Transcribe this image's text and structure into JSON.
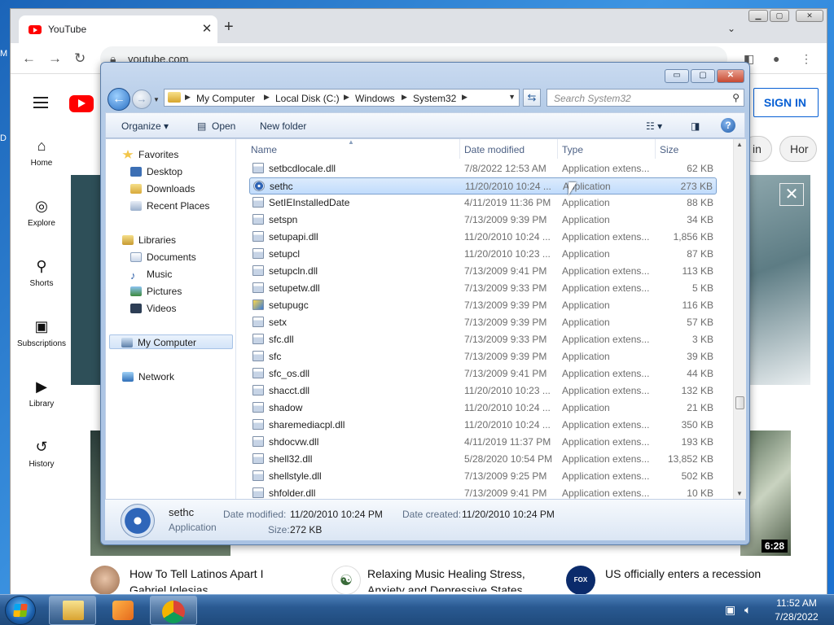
{
  "desktop": {
    "edge_labels": [
      "M",
      "D"
    ]
  },
  "chrome": {
    "tab_title": "YouTube",
    "url": "youtube.com",
    "new_tab": "+",
    "tab_close": "✕",
    "tab_menu": "⌄"
  },
  "youtube": {
    "sign_in": "SIGN IN",
    "sidebar": [
      {
        "label": "Home",
        "icon": "home-icon",
        "glyph": "⌂"
      },
      {
        "label": "Explore",
        "icon": "compass-icon",
        "glyph": "◎"
      },
      {
        "label": "Shorts",
        "icon": "shorts-icon",
        "glyph": "⚲"
      },
      {
        "label": "Subscriptions",
        "icon": "subscriptions-icon",
        "glyph": "▣"
      },
      {
        "label": "Library",
        "icon": "library-icon",
        "glyph": "▶"
      },
      {
        "label": "History",
        "icon": "history-icon",
        "glyph": "↺"
      }
    ],
    "chips": [
      "in",
      "Hor"
    ],
    "banner_close": "✕",
    "videos": [
      {
        "title": "How To Tell Latinos Apart I Gabriel Iglesias",
        "duration": ""
      },
      {
        "title": "Relaxing Music Healing Stress, Anxiety and Depressive States",
        "duration": ""
      },
      {
        "title": "US officially enters a recession",
        "duration": "6:28"
      }
    ],
    "avatar_logo_text": "FOX NEWS"
  },
  "explorer": {
    "caption": {
      "minimize": "▭",
      "maximize": "▢",
      "close": "✕"
    },
    "breadcrumb": [
      "My Computer",
      "Local Disk (C:)",
      "Windows",
      "System32"
    ],
    "search_placeholder": "Search System32",
    "toolbar": {
      "organize": "Organize ▾",
      "open": "Open",
      "new_folder": "New folder",
      "views": "☷ ▾",
      "help": "?"
    },
    "nav": {
      "favorites": "Favorites",
      "desktop": "Desktop",
      "downloads": "Downloads",
      "recent_places": "Recent Places",
      "libraries": "Libraries",
      "documents": "Documents",
      "music": "Music",
      "pictures": "Pictures",
      "videos": "Videos",
      "my_computer": "My Computer",
      "network": "Network"
    },
    "columns": {
      "name": "Name",
      "date_modified": "Date modified",
      "type": "Type",
      "size": "Size"
    },
    "files": [
      {
        "name": "setbcdlocale.dll",
        "date": "7/8/2022 12:53 AM",
        "type": "Application extens...",
        "size": "62 KB",
        "icon": "dll"
      },
      {
        "name": "sethc",
        "date": "11/20/2010 10:24 ...",
        "type": "Application",
        "size": "273 KB",
        "icon": "app-blue"
      },
      {
        "name": "SetIEInstalledDate",
        "date": "4/11/2019 11:36 PM",
        "type": "Application",
        "size": "88 KB",
        "icon": "app"
      },
      {
        "name": "setspn",
        "date": "7/13/2009 9:39 PM",
        "type": "Application",
        "size": "34 KB",
        "icon": "app"
      },
      {
        "name": "setupapi.dll",
        "date": "11/20/2010 10:24 ...",
        "type": "Application extens...",
        "size": "1,856 KB",
        "icon": "dll"
      },
      {
        "name": "setupcl",
        "date": "11/20/2010 10:23 ...",
        "type": "Application",
        "size": "87 KB",
        "icon": "app"
      },
      {
        "name": "setupcln.dll",
        "date": "7/13/2009 9:41 PM",
        "type": "Application extens...",
        "size": "113 KB",
        "icon": "dll"
      },
      {
        "name": "setupetw.dll",
        "date": "7/13/2009 9:33 PM",
        "type": "Application extens...",
        "size": "5 KB",
        "icon": "dll"
      },
      {
        "name": "setupugc",
        "date": "7/13/2009 9:39 PM",
        "type": "Application",
        "size": "116 KB",
        "icon": "app-setup"
      },
      {
        "name": "setx",
        "date": "7/13/2009 9:39 PM",
        "type": "Application",
        "size": "57 KB",
        "icon": "app"
      },
      {
        "name": "sfc.dll",
        "date": "7/13/2009 9:33 PM",
        "type": "Application extens...",
        "size": "3 KB",
        "icon": "dll"
      },
      {
        "name": "sfc",
        "date": "7/13/2009 9:39 PM",
        "type": "Application",
        "size": "39 KB",
        "icon": "app"
      },
      {
        "name": "sfc_os.dll",
        "date": "7/13/2009 9:41 PM",
        "type": "Application extens...",
        "size": "44 KB",
        "icon": "dll"
      },
      {
        "name": "shacct.dll",
        "date": "11/20/2010 10:23 ...",
        "type": "Application extens...",
        "size": "132 KB",
        "icon": "dll"
      },
      {
        "name": "shadow",
        "date": "11/20/2010 10:24 ...",
        "type": "Application",
        "size": "21 KB",
        "icon": "app"
      },
      {
        "name": "sharemediacpl.dll",
        "date": "11/20/2010 10:24 ...",
        "type": "Application extens...",
        "size": "350 KB",
        "icon": "dll"
      },
      {
        "name": "shdocvw.dll",
        "date": "4/11/2019 11:37 PM",
        "type": "Application extens...",
        "size": "193 KB",
        "icon": "dll"
      },
      {
        "name": "shell32.dll",
        "date": "5/28/2020 10:54 PM",
        "type": "Application extens...",
        "size": "13,852 KB",
        "icon": "dll"
      },
      {
        "name": "shellstyle.dll",
        "date": "7/13/2009 9:25 PM",
        "type": "Application extens...",
        "size": "502 KB",
        "icon": "dll"
      },
      {
        "name": "shfolder.dll",
        "date": "7/13/2009 9:41 PM",
        "type": "Application extens...",
        "size": "10 KB",
        "icon": "dll"
      }
    ],
    "selected_file": "sethc",
    "details": {
      "name": "sethc",
      "type": "Application",
      "date_modified_label": "Date modified:",
      "date_modified": "11/20/2010 10:24 PM",
      "size_label": "Size:",
      "size": "272 KB",
      "date_created_label": "Date created:",
      "date_created": "11/20/2010 10:24 PM"
    }
  },
  "taskbar": {
    "time": "11:52 AM",
    "date": "7/28/2022",
    "tray": [
      "network-icon",
      "volume-icon"
    ]
  }
}
